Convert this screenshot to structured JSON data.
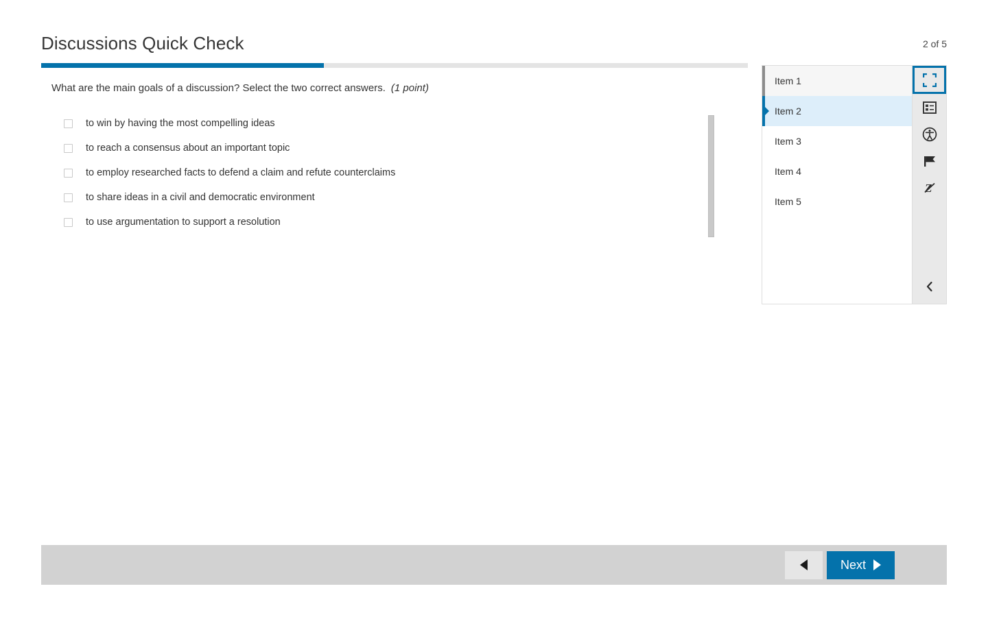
{
  "header": {
    "title": "Discussions Quick Check",
    "item_counter": "2 of 5"
  },
  "progress": {
    "percent": 40,
    "fill_color": "#0472ab",
    "track_color": "#e4e4e4"
  },
  "question": {
    "stem": "What are the main goals of a discussion? Select the two correct answers.",
    "points": "(1 point)",
    "choices": [
      {
        "label": "to win by having the most compelling ideas",
        "checked": false
      },
      {
        "label": "to reach a consensus about an important topic",
        "checked": false
      },
      {
        "label": "to employ researched facts to defend a claim and refute counterclaims",
        "checked": false
      },
      {
        "label": "to share ideas in a civil and democratic environment",
        "checked": false
      },
      {
        "label": "to use argumentation to support a resolution",
        "checked": false
      }
    ]
  },
  "item_list": {
    "items": [
      {
        "label": "Item 1",
        "state": "visited"
      },
      {
        "label": "Item 2",
        "state": "current"
      },
      {
        "label": "Item 3",
        "state": "unvisited"
      },
      {
        "label": "Item 4",
        "state": "unvisited"
      },
      {
        "label": "Item 5",
        "state": "unvisited"
      }
    ]
  },
  "tool_rail": {
    "tools": [
      {
        "icon": "fullscreen-icon",
        "active": true
      },
      {
        "icon": "notes-list-icon",
        "active": false
      },
      {
        "icon": "accessibility-icon",
        "active": false
      },
      {
        "icon": "flag-icon",
        "active": false
      },
      {
        "icon": "line-reader-off-icon",
        "active": false
      }
    ],
    "collapse_icon": "chevron-left-icon",
    "accent_color": "#0472ab"
  },
  "bottom_bar": {
    "prev_icon": "triangle-left-icon",
    "next_label": "Next",
    "next_icon": "triangle-right-icon",
    "next_color": "#0472ab"
  }
}
